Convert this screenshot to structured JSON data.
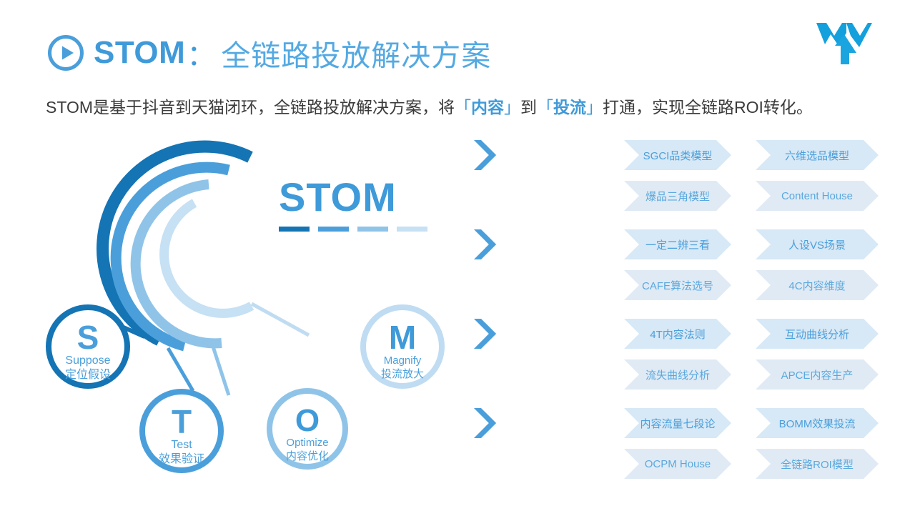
{
  "header": {
    "play_icon": "play-circle-icon",
    "title_main": "STOM",
    "title_colon": "：",
    "title_sub": "全链路投放解决方案",
    "logo_icon": "brand-w-logo"
  },
  "subtitle": {
    "part1": "STOM是基于抖音到天猫闭环，全链路投放解决方案，将",
    "bracket_open_1": "「",
    "hl1": "内容",
    "bracket_close_1": "」",
    "part2": "到",
    "bracket_open_2": "「",
    "hl2": "投流",
    "bracket_close_2": "」",
    "part3": "打通，实现全链路ROI转化。"
  },
  "diagram": {
    "center_title": "STOM",
    "nodes": [
      {
        "letter": "S",
        "en": "Suppose",
        "cn": "定位假设",
        "color": "#1474b4"
      },
      {
        "letter": "T",
        "en": "Test",
        "cn": "效果验证",
        "color": "#4a9fdb"
      },
      {
        "letter": "O",
        "en": "Optimize",
        "cn": "内容优化",
        "color": "#8fc4e8"
      },
      {
        "letter": "M",
        "en": "Magnify",
        "cn": "投流放大",
        "color": "#bfdcf2"
      }
    ],
    "dashes": [
      "#1474b4",
      "#4a9fdb",
      "#8fc4e8",
      "#c6e0f4"
    ],
    "arc_colors": [
      "#1474b4",
      "#4a9fdb",
      "#8fc4e8",
      "#c6e0f4"
    ]
  },
  "rows": [
    {
      "key": "S",
      "label": "S 定位假设",
      "items": [
        "SGCI品类模型",
        "六维选品模型",
        "爆品三角模型",
        "Content House"
      ]
    },
    {
      "key": "T",
      "label": "T 效果验证",
      "items": [
        "一定二辨三看",
        "人设VS场景",
        "CAFE算法选号",
        "4C内容维度"
      ]
    },
    {
      "key": "O",
      "label": "O 内容优化",
      "items": [
        "4T内容法则",
        "互动曲线分析",
        "流失曲线分析",
        "APCE内容生产"
      ]
    },
    {
      "key": "M",
      "label": "M 投流放大",
      "items": [
        "内容流量七段论",
        "BOMM效果投流",
        "OCPM House",
        "全链路ROI模型"
      ]
    }
  ],
  "colors": {
    "brand_blue": "#4a9fdb",
    "dark_blue": "#1474b4",
    "pale_blue": "#d7e8f6",
    "text_dark": "#3b3b3b"
  }
}
